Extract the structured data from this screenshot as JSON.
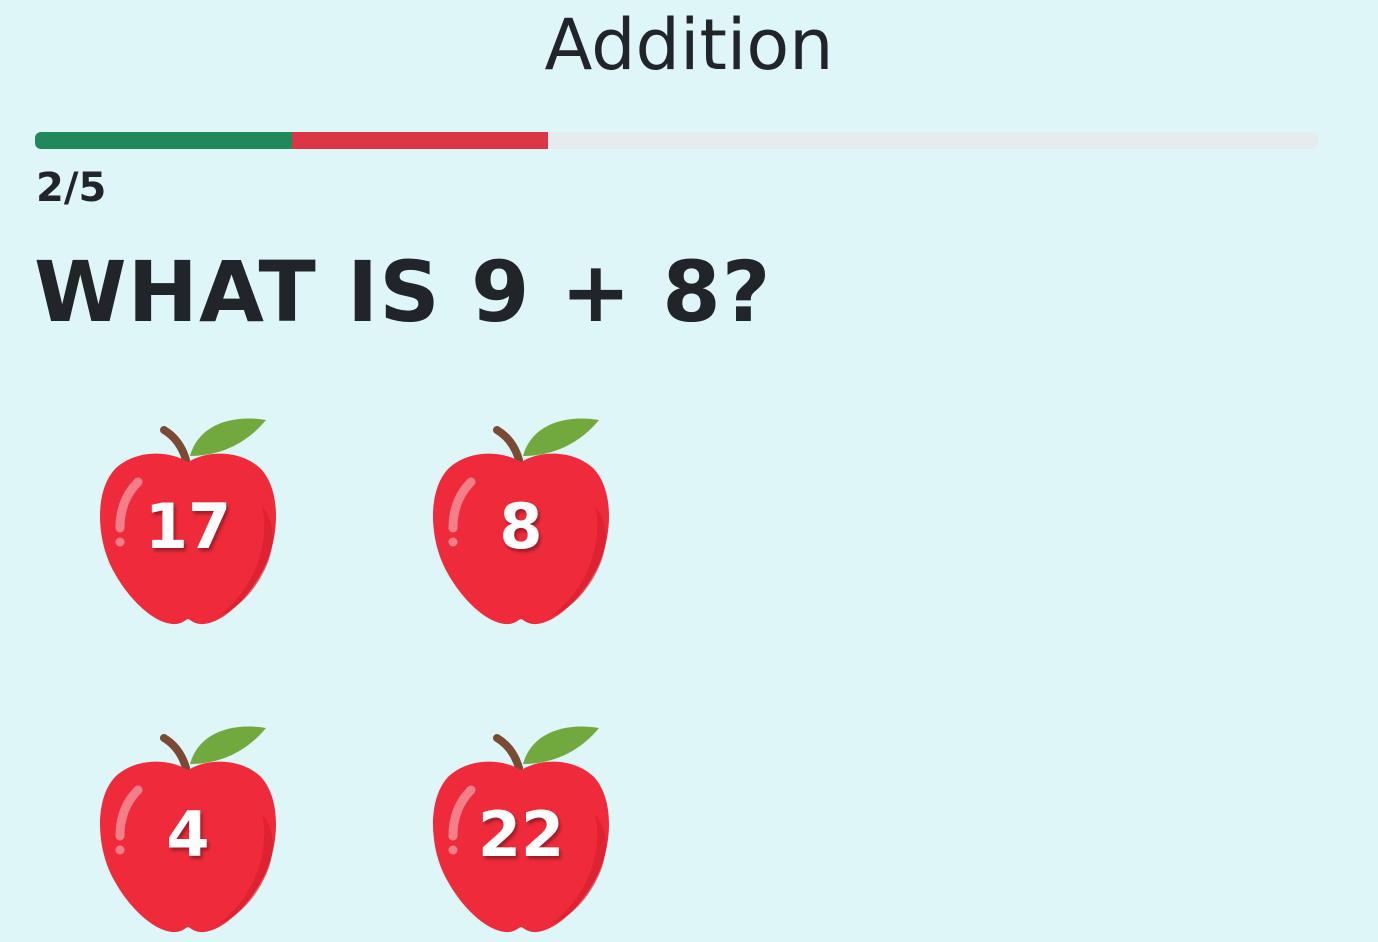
{
  "title": "Addition",
  "progress": {
    "label": "2/5",
    "answered_correct": 1,
    "answered_wrong": 1,
    "total": 5,
    "colors": {
      "correct": "#1e8a5a",
      "wrong": "#dc3545",
      "remaining": "#e6ebee"
    }
  },
  "question": {
    "text": "WHAT IS 9 + 8?"
  },
  "answers": [
    {
      "label": "17",
      "icon": "apple-icon"
    },
    {
      "label": "8",
      "icon": "apple-icon"
    },
    {
      "label": "4",
      "icon": "apple-icon"
    },
    {
      "label": "22",
      "icon": "apple-icon"
    }
  ],
  "colors": {
    "background": "#dff6f8",
    "apple": "#ef2b3b",
    "leaf": "#72a93f",
    "stem": "#7a4a35"
  }
}
